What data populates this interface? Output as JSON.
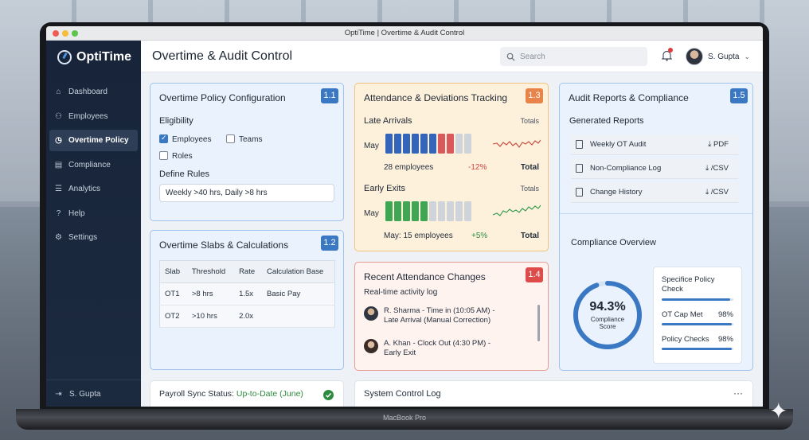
{
  "window": {
    "title": "OptiTime | Overtime & Audit Control"
  },
  "device": {
    "label": "MacBook Pro"
  },
  "brand": {
    "name": "OptiTime"
  },
  "sidebar": {
    "items": [
      {
        "label": "Dashboard",
        "icon": "home-icon"
      },
      {
        "label": "Employees",
        "icon": "users-icon"
      },
      {
        "label": "Overtime Policy",
        "icon": "clock-icon",
        "active": true
      },
      {
        "label": "Compliance",
        "icon": "document-icon"
      },
      {
        "label": "Analytics",
        "icon": "analytics-icon"
      },
      {
        "label": "Help",
        "icon": "help-icon"
      },
      {
        "label": "Settings",
        "icon": "gear-icon"
      }
    ],
    "user": "S. Gupta"
  },
  "header": {
    "title": "Overtime & Audit Control",
    "search_placeholder": "Search",
    "user": "S. Gupta"
  },
  "policy": {
    "title": "Overtime Policy Configuration",
    "badge": "1.1",
    "eligibility_label": "Eligibility",
    "options": [
      {
        "label": "Employees",
        "checked": true
      },
      {
        "label": "Teams",
        "checked": false
      },
      {
        "label": "Roles",
        "checked": false
      }
    ],
    "rules_label": "Define Rules",
    "rules_value": "Weekly >40 hrs, Daily >8 hrs"
  },
  "slabs": {
    "title": "Overtime Slabs & Calculations",
    "badge": "1.2",
    "headers": [
      "Slab",
      "Threshold",
      "Rate",
      "Calculation Base"
    ],
    "rows": [
      [
        "OT1",
        ">8 hrs",
        "1.5x",
        "Basic Pay"
      ],
      [
        "OT2",
        ">10 hrs",
        "2.0x",
        ""
      ]
    ]
  },
  "payroll": {
    "label": "Payroll Sync Status:",
    "status": "Up-to-Date (June)",
    "status_color": "#2e8a3e"
  },
  "attendance": {
    "title": "Attendance & Deviations Tracking",
    "badge": "1.3",
    "late": {
      "label": "Late Arrivals",
      "totals_label": "Totals",
      "month": "May",
      "bars": [
        "blue",
        "blue",
        "blue",
        "blue",
        "blue",
        "blue",
        "red",
        "red",
        "gray",
        "gray"
      ],
      "count_text": "28 employees",
      "change": "-12%",
      "total_label": "Total"
    },
    "early": {
      "label": "Early Exits",
      "totals_label": "Totals",
      "month": "May",
      "bars": [
        "green",
        "green",
        "green",
        "green",
        "green",
        "gray",
        "gray",
        "gray",
        "gray",
        "gray"
      ],
      "count_text": "May: 15 employees",
      "change": "+5%",
      "total_label": "Total"
    }
  },
  "recent": {
    "title": "Recent Attendance Changes",
    "badge": "1.4",
    "subtitle": "Real-time activity log",
    "items": [
      {
        "line1": "R. Sharma - Time in (10:05 AM) -",
        "line2": "Late Arrival (Manual Correction)"
      },
      {
        "line1": "A. Khan - Clock Out (4:30 PM) -",
        "line2": "Early Exit"
      }
    ]
  },
  "system_log": {
    "title": "System Control Log",
    "more": "···"
  },
  "audit": {
    "title": "Audit Reports & Compliance",
    "badge": "1.5",
    "generated_label": "Generated Reports",
    "reports": [
      {
        "name": "Weekly OT Audit",
        "format": "PDF"
      },
      {
        "name": "Non-Compliance Log",
        "format": "/CSV"
      },
      {
        "name": "Change History",
        "format": "/CSV"
      }
    ],
    "overview_title": "Compliance Overview",
    "score": "94.3%",
    "score_value": 0.943,
    "score_label": "Compliance Score",
    "metrics": [
      {
        "label": "Specifice Policy Check",
        "value": "",
        "fill": 0.95
      },
      {
        "label": "OT Cap Met",
        "value": "98%",
        "fill": 0.98
      },
      {
        "label": "Policy Checks",
        "value": "98%",
        "fill": 0.98
      }
    ]
  },
  "colors": {
    "accent": "#3b78c4",
    "late_red": "#d9595d",
    "early_green": "#3fa654",
    "negative": "#d24343",
    "positive": "#2e8a3e"
  }
}
